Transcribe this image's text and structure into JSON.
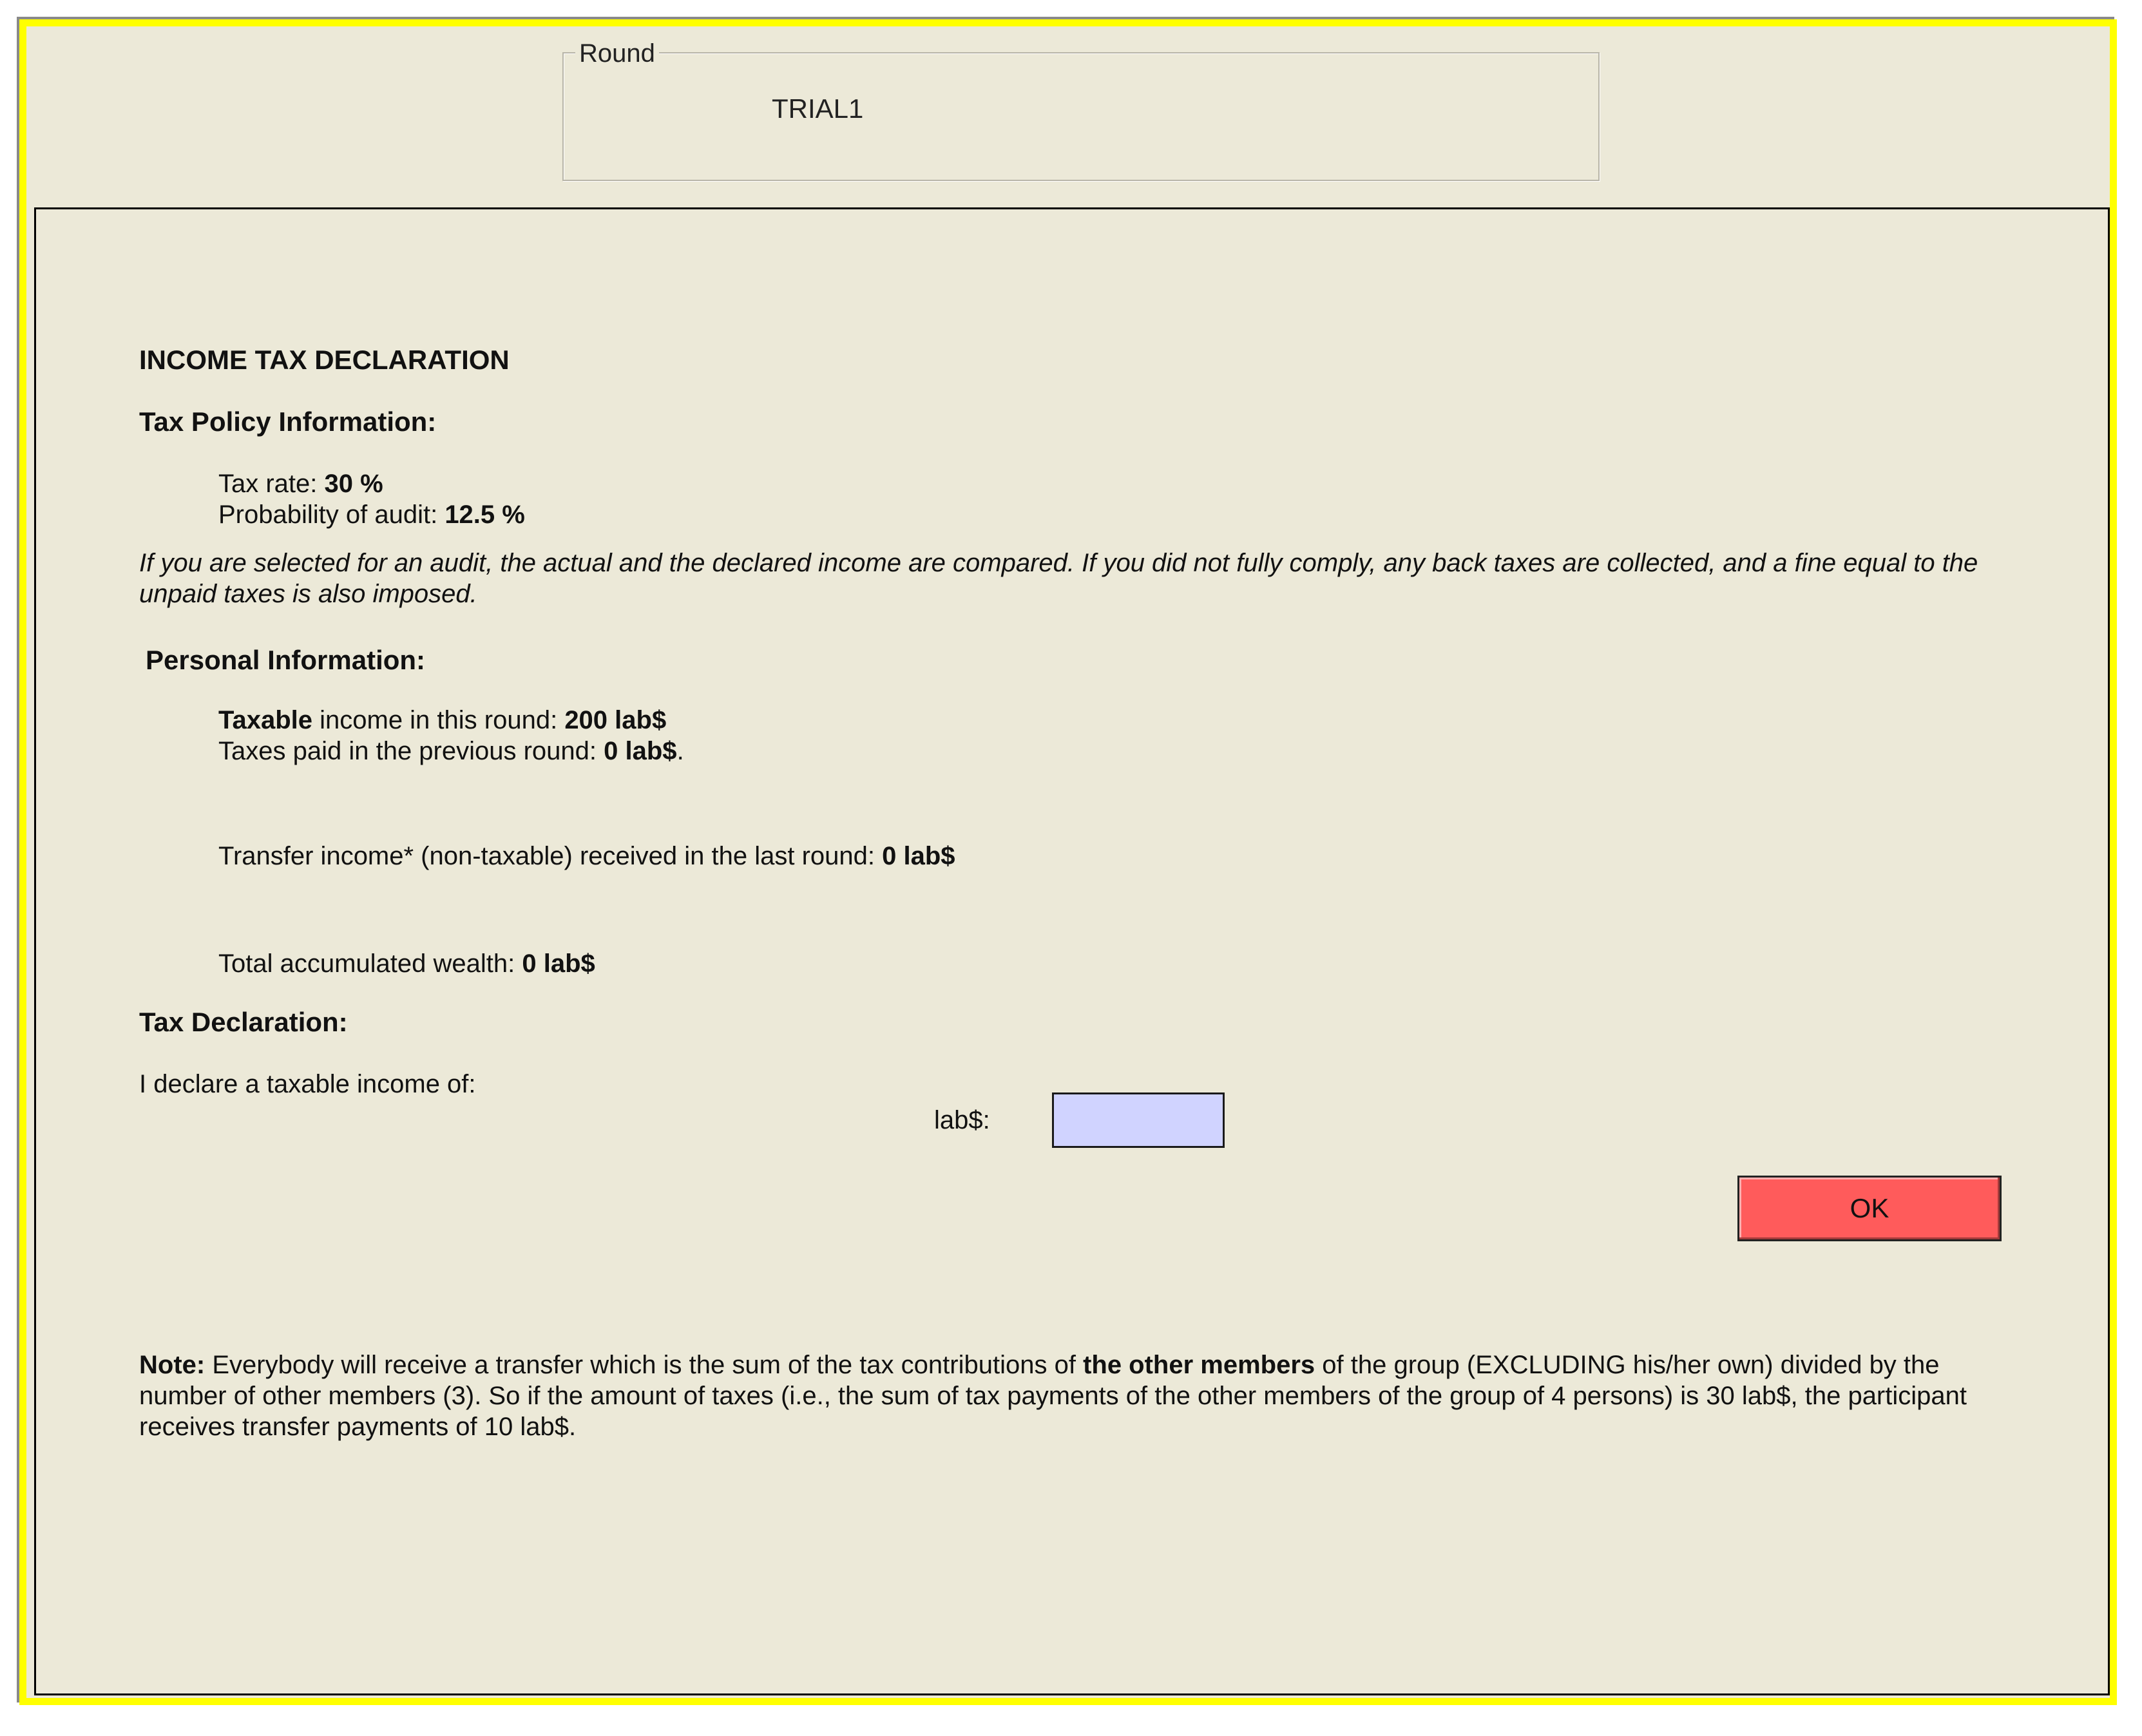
{
  "round": {
    "legend": "Round",
    "value": "TRIAL1"
  },
  "form": {
    "title": "INCOME TAX DECLARATION",
    "tax_policy": {
      "heading": "Tax Policy Information:",
      "tax_rate_label": "Tax rate: ",
      "tax_rate_value": "30 %",
      "audit_label": "Probability of audit: ",
      "audit_value": "12.5 %"
    },
    "audit_explanation": "If you are selected for an audit, the actual and the declared income are compared. If you did not fully comply, any back taxes are collected, and a fine equal to the unpaid taxes is also imposed.",
    "personal": {
      "heading": "Personal Information:",
      "taxable_word": "Taxable",
      "income_label": " income in this round: ",
      "income_value": "200 lab$",
      "taxes_paid_label": "Taxes paid in the previous round: ",
      "taxes_paid_value": "0 lab$",
      "taxes_paid_suffix": ".",
      "transfer_label": "Transfer income* (non-taxable) received in the last round:  ",
      "transfer_value": "0 lab$",
      "wealth_label": "Total accumulated wealth:  ",
      "wealth_value": "0 lab$"
    },
    "declaration": {
      "heading": "Tax Declaration:",
      "prompt": "I declare a taxable income of:",
      "currency_label": "lab$:",
      "input_value": ""
    },
    "ok_label": "OK",
    "note": {
      "lead": "Note:",
      "text1": " Everybody will receive a transfer which is the sum of the tax contributions of ",
      "bold": "the other members",
      "text2": " of the group (EXCLUDING his/her own) divided by the number of other members (3). So if the amount of taxes (i.e., the sum of tax payments of the other members of the group of 4 persons) is 30  lab$, the participant receives transfer payments of 10 lab$."
    }
  },
  "colors": {
    "window_bg": "#ece9d8",
    "frame": "#ffff00",
    "input_bg": "#d0d3ff",
    "ok_button": "#ff5b5b"
  }
}
